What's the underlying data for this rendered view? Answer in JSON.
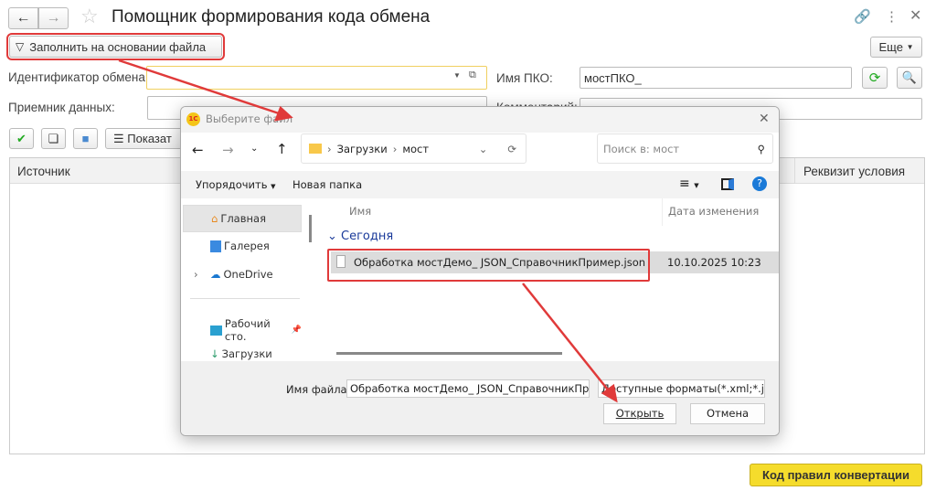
{
  "header": {
    "title": "Помощник формирования кода обмена",
    "more_label": "Еще"
  },
  "toolbar": {
    "fill_from_file": "Заполнить на основании файла",
    "show_label": "Показат"
  },
  "form": {
    "exchange_id_label": "Идентификатор обмена:",
    "exchange_id_value": "",
    "receiver_label": "Приемник данных:",
    "receiver_value": "",
    "pko_name_label": "Имя ПКО:",
    "pko_name_value": "мостПКО_",
    "comment_label": "Комментарий:"
  },
  "table": {
    "columns": [
      "Источник",
      "Реквизит условия"
    ]
  },
  "footer": {
    "convert_button": "Код правил конвертации"
  },
  "dialog": {
    "title": "Выберите файл",
    "breadcrumb": [
      "Загрузки",
      "мост"
    ],
    "search_placeholder": "Поиск в: мост",
    "organize": "Упорядочить",
    "new_folder": "Новая папка",
    "sidebar": [
      "Главная",
      "Галерея",
      "OneDrive",
      "Рабочий сто.",
      "Загрузки"
    ],
    "col_name": "Имя",
    "col_date": "Дата изменения",
    "group": "Сегодня",
    "files": [
      {
        "name": "Обработка мостДемо_ JSON_СправочникПример.json",
        "date": "10.10.2025 10:23"
      }
    ],
    "filename_label": "Имя файла:",
    "filename_value": "Обработка мостДемо_ JSON_СправочникПри",
    "filter": "Доступные форматы(*.xml;*.jsc",
    "open": "Открыть",
    "cancel": "Отмена"
  },
  "colors": {
    "accent_red": "#e03a3a",
    "yellow": "#f5dc2c"
  }
}
